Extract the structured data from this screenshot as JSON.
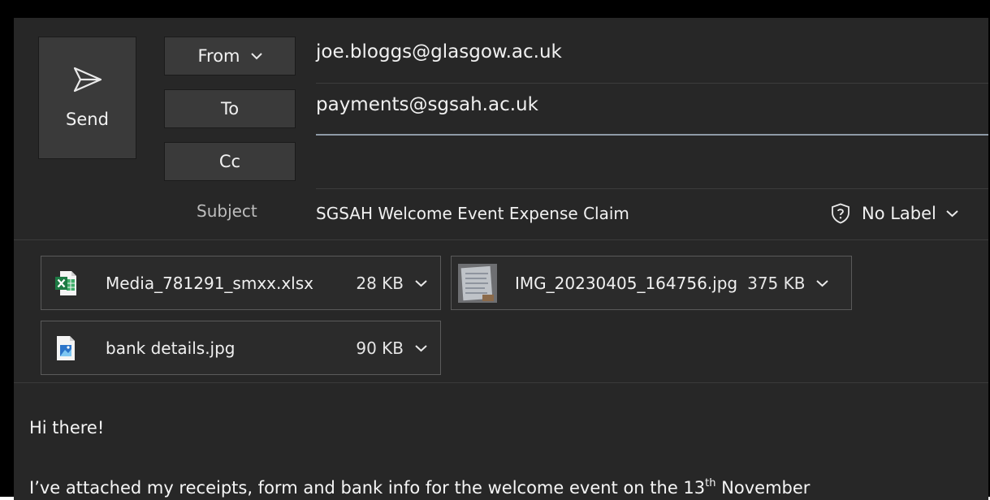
{
  "compose": {
    "send_label": "Send",
    "from_label": "From",
    "to_label": "To",
    "cc_label": "Cc",
    "subject_label": "Subject",
    "from_value": "joe.bloggs@glasgow.ac.uk",
    "to_value": "payments@sgsah.ac.uk",
    "cc_value": "",
    "subject_value": "SGSAH Welcome Event Expense Claim",
    "sensitivity_label": "No Label"
  },
  "attachments": [
    {
      "name": "Media_781291_smxx.xlsx",
      "size": "28 KB",
      "icon": "excel-file-icon"
    },
    {
      "name": "IMG_20230405_164756.jpg",
      "size": "375 KB",
      "icon": "image-thumbnail"
    },
    {
      "name": "bank details.jpg",
      "size": "90 KB",
      "icon": "image-file-icon"
    }
  ],
  "body": {
    "greeting": "Hi there!",
    "line_start": "I’ve attached my receipts, form and bank info for the welcome event on the 13",
    "line_sup": "th",
    "line_end": " November"
  },
  "colors": {
    "background": "#272727",
    "button": "#3a3a3a",
    "active_underline": "#8e9aa6",
    "excel_green": "#1d7a44",
    "image_blue": "#2b74c9"
  }
}
